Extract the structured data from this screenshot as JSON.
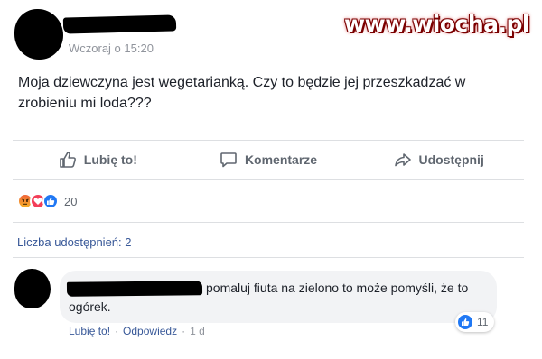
{
  "post": {
    "timestamp": "Wczoraj o 15:20",
    "text": "Moja dziewczyna jest wegetarianką.  Czy to będzie jej przeszkadzać w zrobieniu mi loda???",
    "watermark": "www.wiocha.pl"
  },
  "actions": {
    "like_label": "Lubię to!",
    "comment_label": "Komentarze",
    "share_label": "Udostępnij"
  },
  "reactions": {
    "count": "20",
    "icons": [
      "angry-emoji",
      "heart",
      "thumbs-up"
    ]
  },
  "shares": {
    "label": "Liczba udostępnień: 2"
  },
  "comment": {
    "text": "pomaluj fiuta na zielono to może pomyśli, że to ogórek.",
    "reaction_count": "11",
    "like_label": "Lubię to!",
    "reply_label": "Odpowiedz",
    "separator": "·",
    "time": "1 d"
  },
  "colors": {
    "link": "#385898",
    "like_blue": "#2078f4",
    "love_red": "#f33e58",
    "muted": "#90949c"
  }
}
